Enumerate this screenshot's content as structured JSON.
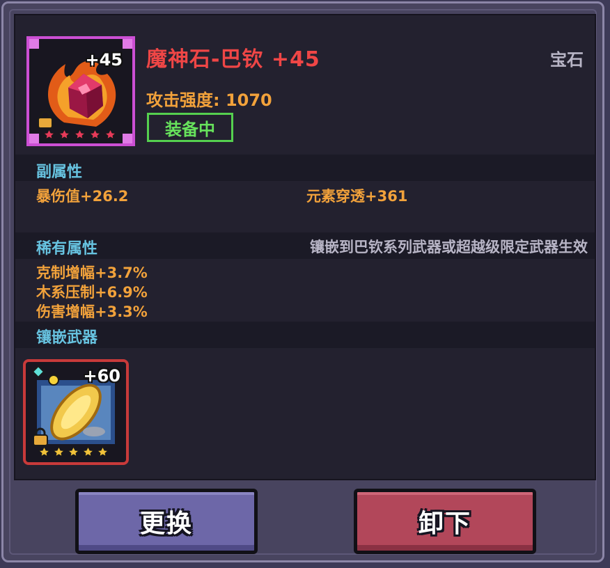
{
  "item": {
    "name": "魔神石-巴钦 +45",
    "type": "宝石",
    "enhance_badge": "+45",
    "attack": "攻击强度: 1070",
    "status": "装备中",
    "icon": "magic-gem-icon",
    "stars": 5
  },
  "secondary": {
    "title": "副属性",
    "stats": [
      "暴伤值+26.2",
      "元素穿透+361"
    ]
  },
  "rare": {
    "title": "稀有属性",
    "note": "镶嵌到巴钦系列武器或超越级限定武器生效",
    "stats": [
      "克制增幅+3.7%",
      "木系压制+6.9%",
      "伤害增幅+3.3%"
    ]
  },
  "inlay": {
    "title": "镶嵌武器",
    "weapon_badge": "+60",
    "icon": "weapon-disc-icon",
    "stars": 5
  },
  "buttons": {
    "replace": "更换",
    "unequip": "卸下"
  },
  "colors": {
    "name": "#ef4646",
    "stat": "#f2a23b",
    "section": "#67c3e0",
    "equipped": "#55d04f",
    "gem_frame": "#cc4fd4",
    "weapon_frame": "#c83a3a"
  }
}
